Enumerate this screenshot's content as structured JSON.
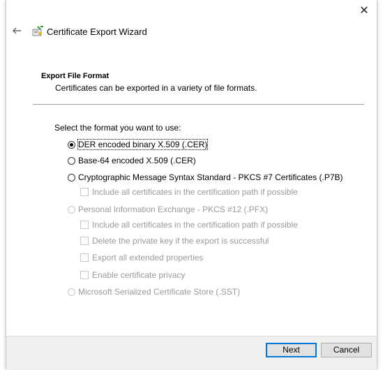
{
  "wizard": {
    "title": "Certificate Export Wizard"
  },
  "section": {
    "title": "Export File Format",
    "subtitle": "Certificates can be exported in a variety of file formats."
  },
  "prompt": "Select the format you want to use:",
  "options": {
    "der": "DER encoded binary X.509 (.CER)",
    "base64": "Base-64 encoded X.509 (.CER)",
    "pkcs7": "Cryptographic Message Syntax Standard - PKCS #7 Certificates (.P7B)",
    "pkcs7_include": "Include all certificates in the certification path if possible",
    "pfx": "Personal Information Exchange - PKCS #12 (.PFX)",
    "pfx_include": "Include all certificates in the certification path if possible",
    "pfx_delete": "Delete the private key if the export is successful",
    "pfx_export_props": "Export all extended properties",
    "pfx_privacy": "Enable certificate privacy",
    "sst": "Microsoft Serialized Certificate Store (.SST)"
  },
  "selected_option": "der",
  "buttons": {
    "next": "Next",
    "cancel": "Cancel"
  },
  "colors": {
    "accent": "#0078d7",
    "disabled_text": "#9a9a9a",
    "footer_bg": "#f0f0f0"
  },
  "icons": {
    "close": "close-icon",
    "back": "back-arrow-icon",
    "wizard": "certificate-icon"
  }
}
